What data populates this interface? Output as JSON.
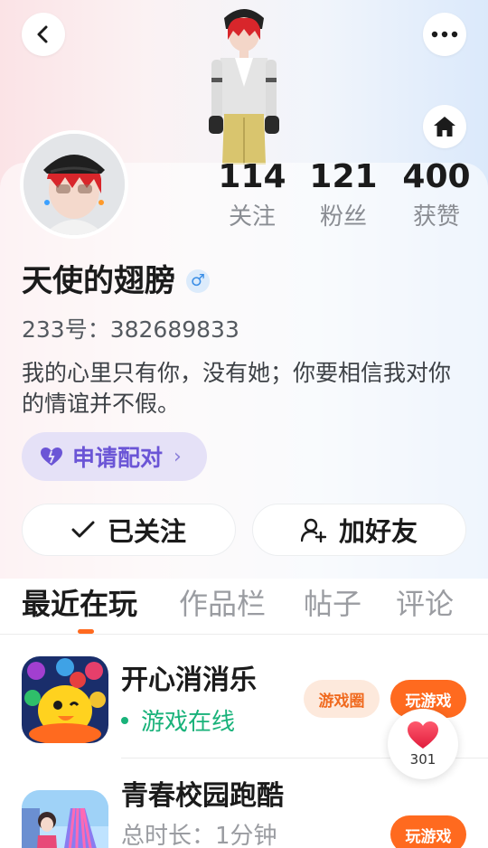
{
  "header": {
    "back_icon": "chevron-left-icon",
    "more_icon": "more-dots-icon",
    "home_icon": "home-icon"
  },
  "profile": {
    "stats": [
      {
        "value": "114",
        "label": "关注"
      },
      {
        "value": "121",
        "label": "粉丝"
      },
      {
        "value": "400",
        "label": "获赞"
      }
    ],
    "nickname": "天使的翅膀",
    "gender_symbol": "♂",
    "uid": "233号：382689833",
    "bio": "我的心里只有你，没有她；你要相信我对你的情谊并不假。",
    "pair_label": "申请配对",
    "pair_chevron": "›"
  },
  "actions": {
    "follow_label": "已关注",
    "add_friend_label": "加好友"
  },
  "tabs": [
    {
      "label": "最近在玩",
      "active": true
    },
    {
      "label": "作品栏",
      "active": false
    },
    {
      "label": "帖子",
      "active": false
    },
    {
      "label": "评论",
      "active": false
    }
  ],
  "games": [
    {
      "title": "开心消消乐",
      "status": "游戏在线",
      "circle_label": "游戏圈",
      "play_label": "玩游戏"
    },
    {
      "title": "青春校园跑酷",
      "status": "总时长：1分钟",
      "play_label": "玩游戏"
    }
  ],
  "like_float": {
    "count": "301"
  },
  "colors": {
    "accent_orange": "#ff6a1f",
    "online_green": "#19b27a",
    "pair_purple": "#6b55d6"
  }
}
